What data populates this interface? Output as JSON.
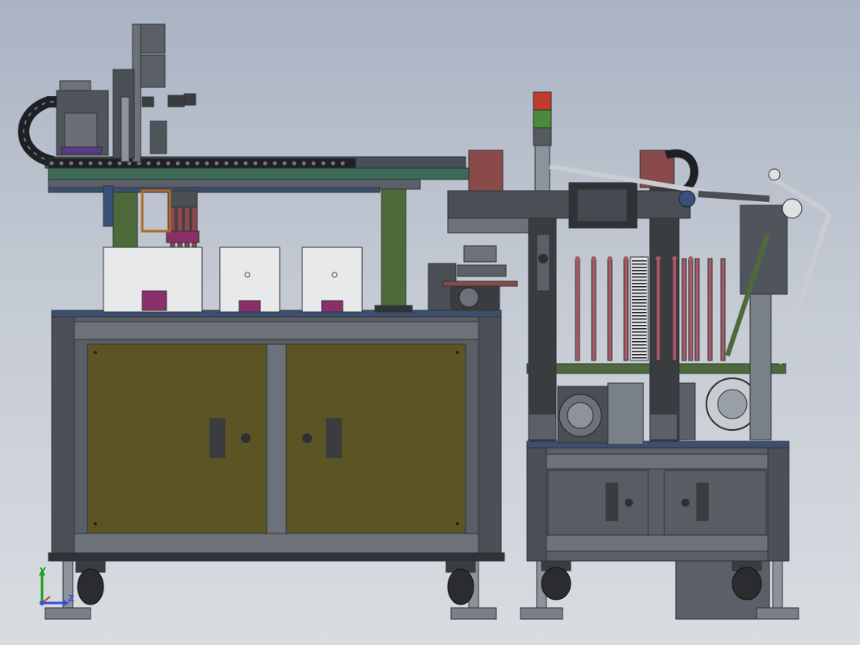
{
  "viewport": {
    "background_top": "#a9b3c3",
    "background_bottom": "#d9dce1"
  },
  "model": {
    "description_icons": [
      "cable-chain",
      "gantry",
      "cabinet",
      "stack-light",
      "tube-rack",
      "casters"
    ],
    "colors": {
      "frame": "#5a5f66",
      "frame_dark": "#2f3338",
      "panel_olive": "#5b5526",
      "column_green": "#4d6b3a",
      "accent_red": "#8a4a4a",
      "tube_red": "#a85a66",
      "white_box": "#e8e9ea",
      "magenta": "#8a2f6a",
      "steel": "#9aa0a8",
      "top_plate": "#3c4f6e"
    },
    "stack_light_colors": [
      "#c23a2a",
      "#4a8a3a",
      "#555a60"
    ]
  },
  "triad": {
    "y_label": "Y",
    "z_label": "Z"
  }
}
